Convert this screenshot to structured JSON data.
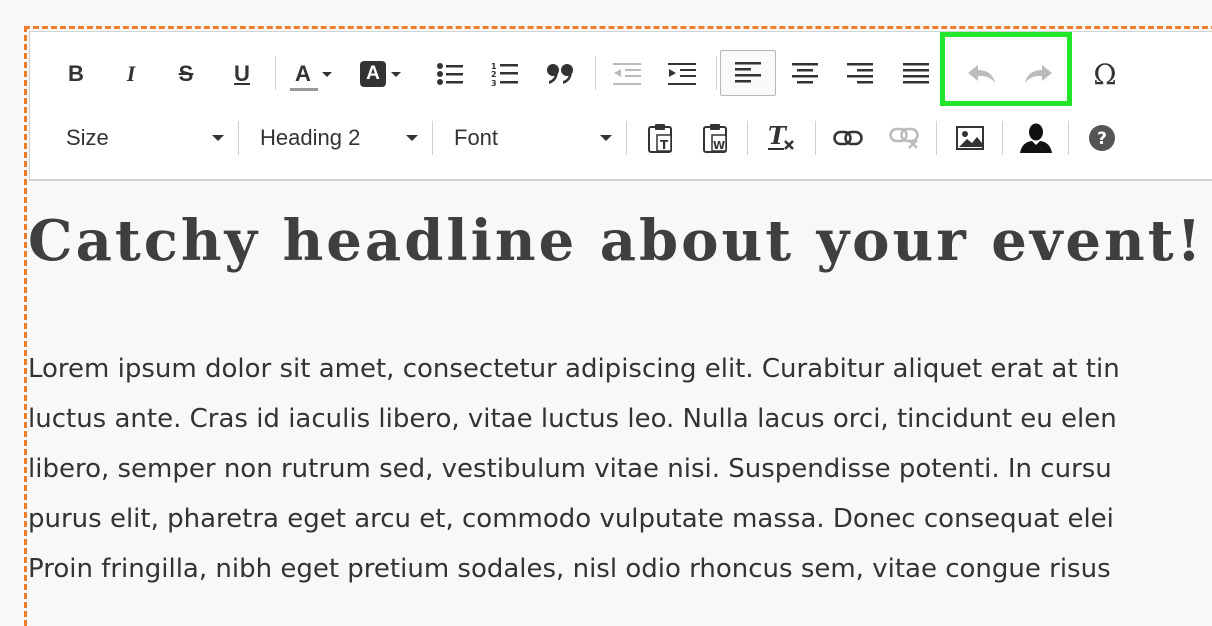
{
  "toolbar": {
    "row1": {
      "bold": "B",
      "italic": "I",
      "strike": "S",
      "underline": "U",
      "text_color": "A",
      "bg_color": "A",
      "special_char": "Ω"
    },
    "size_label": "Size",
    "format_label": "Heading 2",
    "font_label": "Font",
    "highlight_color": "#22e62a"
  },
  "content": {
    "headline": "Catchy headline about your event!",
    "paragraph_lines": [
      "Lorem ipsum dolor sit amet, consectetur adipiscing elit. Curabitur aliquet erat at tin",
      "luctus ante. Cras id iaculis libero, vitae luctus leo. Nulla lacus orci, tincidunt eu elen",
      "libero, semper non rutrum sed, vestibulum vitae nisi. Suspendisse potenti. In cursu",
      "purus elit, pharetra eget arcu et, commodo vulputate massa. Donec consequat elei",
      "Proin fringilla, nibh eget pretium sodales, nisl odio rhoncus sem, vitae congue risus"
    ]
  },
  "colors": {
    "frame": "#ef7d2a",
    "text": "#333333"
  }
}
